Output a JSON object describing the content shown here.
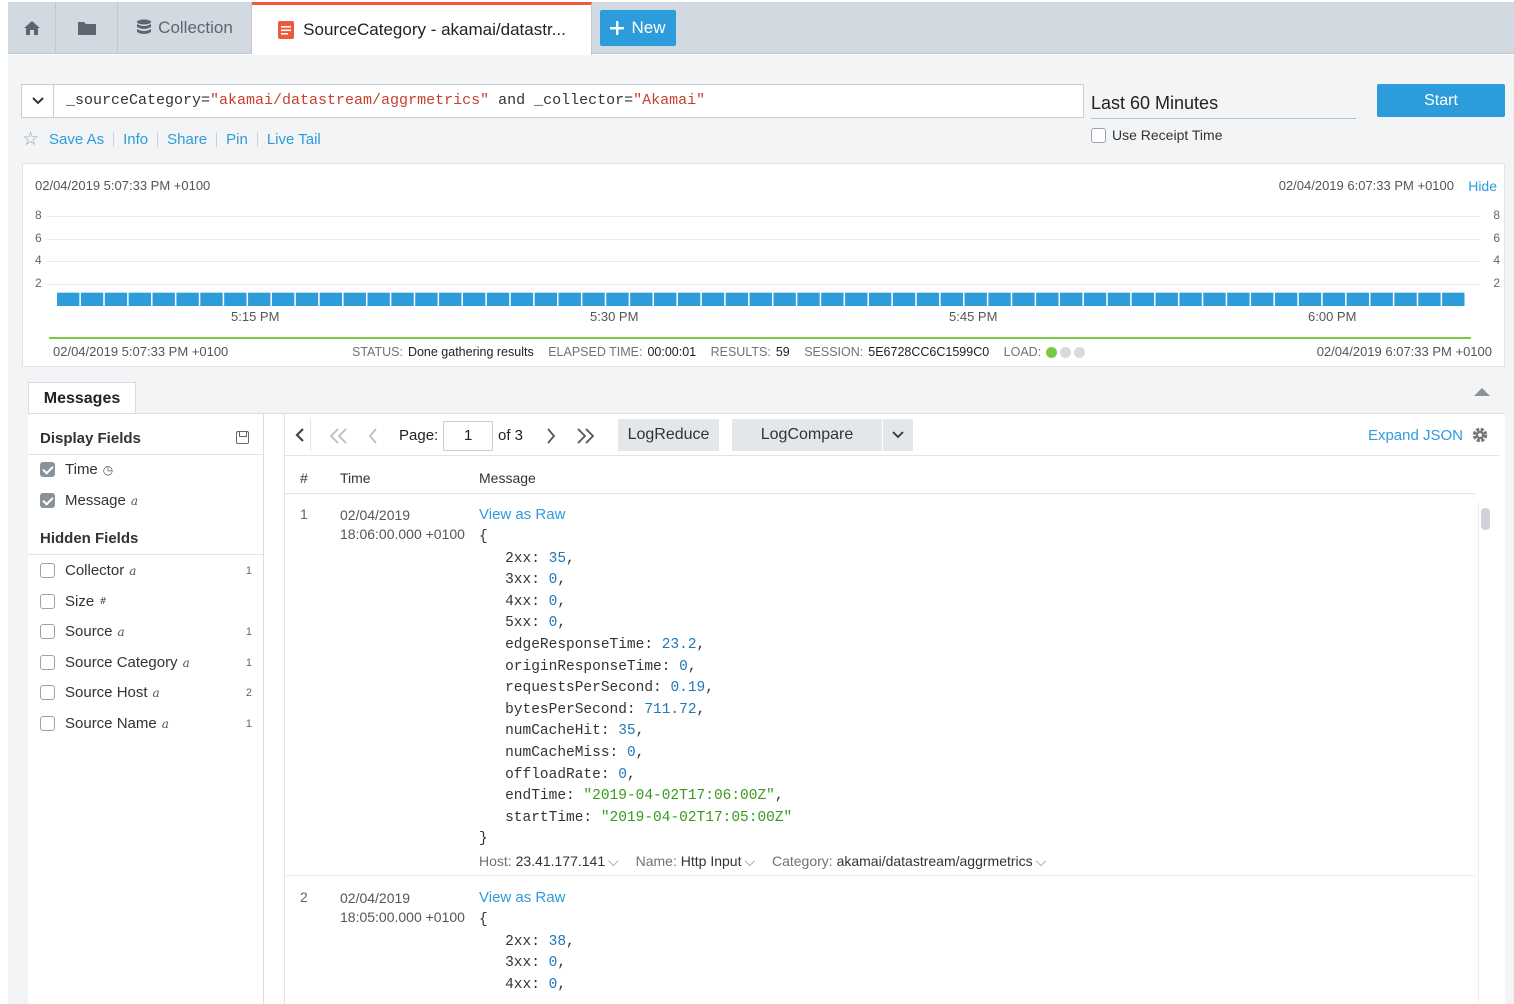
{
  "tabs": {
    "collection": "Collection",
    "active": "SourceCategory - akamai/datastr...",
    "new": "New"
  },
  "query": {
    "p1": "_sourceCategory=",
    "v1": "\"akamai/datastream/aggrmetrics\"",
    "p2": " and _collector=",
    "v2": "\"Akamai\"",
    "time_range": "Last 60 Minutes",
    "start": "Start",
    "receipt": "Use Receipt Time"
  },
  "actions": {
    "save_as": "Save As",
    "info": "Info",
    "share": "Share",
    "pin": "Pin",
    "live_tail": "Live Tail"
  },
  "histogram": {
    "start_ts": "02/04/2019 5:07:33 PM +0100",
    "end_ts": "02/04/2019 6:07:33 PM +0100",
    "hide": "Hide",
    "status_label": "STATUS:",
    "status": "Done gathering results",
    "elapsed_label": "ELAPSED TIME:",
    "elapsed": "00:00:01",
    "results_label": "RESULTS:",
    "results": "59",
    "session_label": "SESSION:",
    "session": "5E6728CC6C1599C0",
    "load_label": "LOAD:"
  },
  "chart_data": {
    "type": "bar",
    "yticks": [
      "8",
      "6",
      "4",
      "2"
    ],
    "xticks": [
      "5:15 PM",
      "5:30 PM",
      "5:45 PM",
      "6:00 PM"
    ],
    "bar_count": 59,
    "value_each": 1,
    "ylim": [
      0,
      9
    ],
    "bar_color": "#2d9cdb"
  },
  "messages": {
    "tab": "Messages",
    "display_fields": "Display Fields",
    "hidden_fields": "Hidden Fields",
    "fields_display": [
      {
        "name": "Time",
        "type": "◷"
      },
      {
        "name": "Message",
        "type": "a"
      }
    ],
    "fields_hidden": [
      {
        "name": "Collector",
        "type": "a",
        "count": "1"
      },
      {
        "name": "Size",
        "type": "#",
        "count": ""
      },
      {
        "name": "Source",
        "type": "a",
        "count": "1"
      },
      {
        "name": "Source Category",
        "type": "a",
        "count": "1"
      },
      {
        "name": "Source Host",
        "type": "a",
        "count": "2"
      },
      {
        "name": "Source Name",
        "type": "a",
        "count": "1"
      }
    ],
    "page_label": "Page:",
    "page_value": "1",
    "of_label": "of 3",
    "logreduce": "LogReduce",
    "logcompare": "LogCompare",
    "expand_json": "Expand JSON",
    "col_num": "#",
    "col_time": "Time",
    "col_message": "Message",
    "view_raw": "View as Raw",
    "rows": [
      {
        "num": "1",
        "date": "02/04/2019",
        "time": "18:06:00.000 +0100",
        "fields": [
          [
            "2xx",
            "35"
          ],
          [
            "3xx",
            "0"
          ],
          [
            "4xx",
            "0"
          ],
          [
            "5xx",
            "0"
          ],
          [
            "edgeResponseTime",
            "23.2"
          ],
          [
            "originResponseTime",
            "0"
          ],
          [
            "requestsPerSecond",
            "0.19"
          ],
          [
            "bytesPerSecond",
            "711.72"
          ],
          [
            "numCacheHit",
            "35"
          ],
          [
            "numCacheMiss",
            "0"
          ],
          [
            "offloadRate",
            "0"
          ],
          [
            "endTime",
            "\"2019-04-02T17:06:00Z\""
          ],
          [
            "startTime",
            "\"2019-04-02T17:05:00Z\""
          ]
        ],
        "host_label": "Host:",
        "host": "23.41.177.141",
        "name_label": "Name:",
        "name": "Http Input",
        "category_label": "Category:",
        "category": "akamai/datastream/aggrmetrics"
      },
      {
        "num": "2",
        "date": "02/04/2019",
        "time": "18:05:00.000 +0100",
        "fields": [
          [
            "2xx",
            "38"
          ],
          [
            "3xx",
            "0"
          ],
          [
            "4xx",
            "0"
          ]
        ]
      }
    ]
  }
}
